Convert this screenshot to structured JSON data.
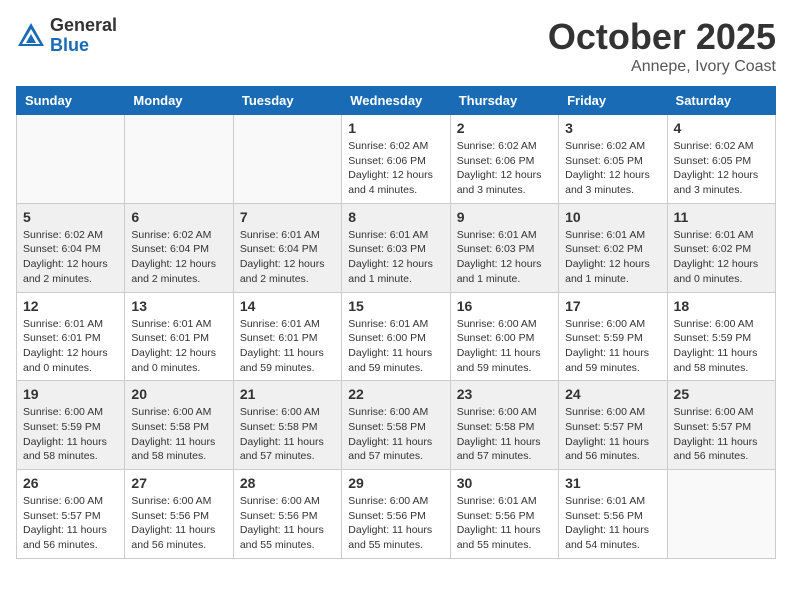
{
  "header": {
    "logo_general": "General",
    "logo_blue": "Blue",
    "month_title": "October 2025",
    "location": "Annepe, Ivory Coast"
  },
  "weekdays": [
    "Sunday",
    "Monday",
    "Tuesday",
    "Wednesday",
    "Thursday",
    "Friday",
    "Saturday"
  ],
  "weeks": [
    [
      {
        "day": "",
        "info": ""
      },
      {
        "day": "",
        "info": ""
      },
      {
        "day": "",
        "info": ""
      },
      {
        "day": "1",
        "info": "Sunrise: 6:02 AM\nSunset: 6:06 PM\nDaylight: 12 hours\nand 4 minutes."
      },
      {
        "day": "2",
        "info": "Sunrise: 6:02 AM\nSunset: 6:06 PM\nDaylight: 12 hours\nand 3 minutes."
      },
      {
        "day": "3",
        "info": "Sunrise: 6:02 AM\nSunset: 6:05 PM\nDaylight: 12 hours\nand 3 minutes."
      },
      {
        "day": "4",
        "info": "Sunrise: 6:02 AM\nSunset: 6:05 PM\nDaylight: 12 hours\nand 3 minutes."
      }
    ],
    [
      {
        "day": "5",
        "info": "Sunrise: 6:02 AM\nSunset: 6:04 PM\nDaylight: 12 hours\nand 2 minutes."
      },
      {
        "day": "6",
        "info": "Sunrise: 6:02 AM\nSunset: 6:04 PM\nDaylight: 12 hours\nand 2 minutes."
      },
      {
        "day": "7",
        "info": "Sunrise: 6:01 AM\nSunset: 6:04 PM\nDaylight: 12 hours\nand 2 minutes."
      },
      {
        "day": "8",
        "info": "Sunrise: 6:01 AM\nSunset: 6:03 PM\nDaylight: 12 hours\nand 1 minute."
      },
      {
        "day": "9",
        "info": "Sunrise: 6:01 AM\nSunset: 6:03 PM\nDaylight: 12 hours\nand 1 minute."
      },
      {
        "day": "10",
        "info": "Sunrise: 6:01 AM\nSunset: 6:02 PM\nDaylight: 12 hours\nand 1 minute."
      },
      {
        "day": "11",
        "info": "Sunrise: 6:01 AM\nSunset: 6:02 PM\nDaylight: 12 hours\nand 0 minutes."
      }
    ],
    [
      {
        "day": "12",
        "info": "Sunrise: 6:01 AM\nSunset: 6:01 PM\nDaylight: 12 hours\nand 0 minutes."
      },
      {
        "day": "13",
        "info": "Sunrise: 6:01 AM\nSunset: 6:01 PM\nDaylight: 12 hours\nand 0 minutes."
      },
      {
        "day": "14",
        "info": "Sunrise: 6:01 AM\nSunset: 6:01 PM\nDaylight: 11 hours\nand 59 minutes."
      },
      {
        "day": "15",
        "info": "Sunrise: 6:01 AM\nSunset: 6:00 PM\nDaylight: 11 hours\nand 59 minutes."
      },
      {
        "day": "16",
        "info": "Sunrise: 6:00 AM\nSunset: 6:00 PM\nDaylight: 11 hours\nand 59 minutes."
      },
      {
        "day": "17",
        "info": "Sunrise: 6:00 AM\nSunset: 5:59 PM\nDaylight: 11 hours\nand 59 minutes."
      },
      {
        "day": "18",
        "info": "Sunrise: 6:00 AM\nSunset: 5:59 PM\nDaylight: 11 hours\nand 58 minutes."
      }
    ],
    [
      {
        "day": "19",
        "info": "Sunrise: 6:00 AM\nSunset: 5:59 PM\nDaylight: 11 hours\nand 58 minutes."
      },
      {
        "day": "20",
        "info": "Sunrise: 6:00 AM\nSunset: 5:58 PM\nDaylight: 11 hours\nand 58 minutes."
      },
      {
        "day": "21",
        "info": "Sunrise: 6:00 AM\nSunset: 5:58 PM\nDaylight: 11 hours\nand 57 minutes."
      },
      {
        "day": "22",
        "info": "Sunrise: 6:00 AM\nSunset: 5:58 PM\nDaylight: 11 hours\nand 57 minutes."
      },
      {
        "day": "23",
        "info": "Sunrise: 6:00 AM\nSunset: 5:58 PM\nDaylight: 11 hours\nand 57 minutes."
      },
      {
        "day": "24",
        "info": "Sunrise: 6:00 AM\nSunset: 5:57 PM\nDaylight: 11 hours\nand 56 minutes."
      },
      {
        "day": "25",
        "info": "Sunrise: 6:00 AM\nSunset: 5:57 PM\nDaylight: 11 hours\nand 56 minutes."
      }
    ],
    [
      {
        "day": "26",
        "info": "Sunrise: 6:00 AM\nSunset: 5:57 PM\nDaylight: 11 hours\nand 56 minutes."
      },
      {
        "day": "27",
        "info": "Sunrise: 6:00 AM\nSunset: 5:56 PM\nDaylight: 11 hours\nand 56 minutes."
      },
      {
        "day": "28",
        "info": "Sunrise: 6:00 AM\nSunset: 5:56 PM\nDaylight: 11 hours\nand 55 minutes."
      },
      {
        "day": "29",
        "info": "Sunrise: 6:00 AM\nSunset: 5:56 PM\nDaylight: 11 hours\nand 55 minutes."
      },
      {
        "day": "30",
        "info": "Sunrise: 6:01 AM\nSunset: 5:56 PM\nDaylight: 11 hours\nand 55 minutes."
      },
      {
        "day": "31",
        "info": "Sunrise: 6:01 AM\nSunset: 5:56 PM\nDaylight: 11 hours\nand 54 minutes."
      },
      {
        "day": "",
        "info": ""
      }
    ]
  ]
}
